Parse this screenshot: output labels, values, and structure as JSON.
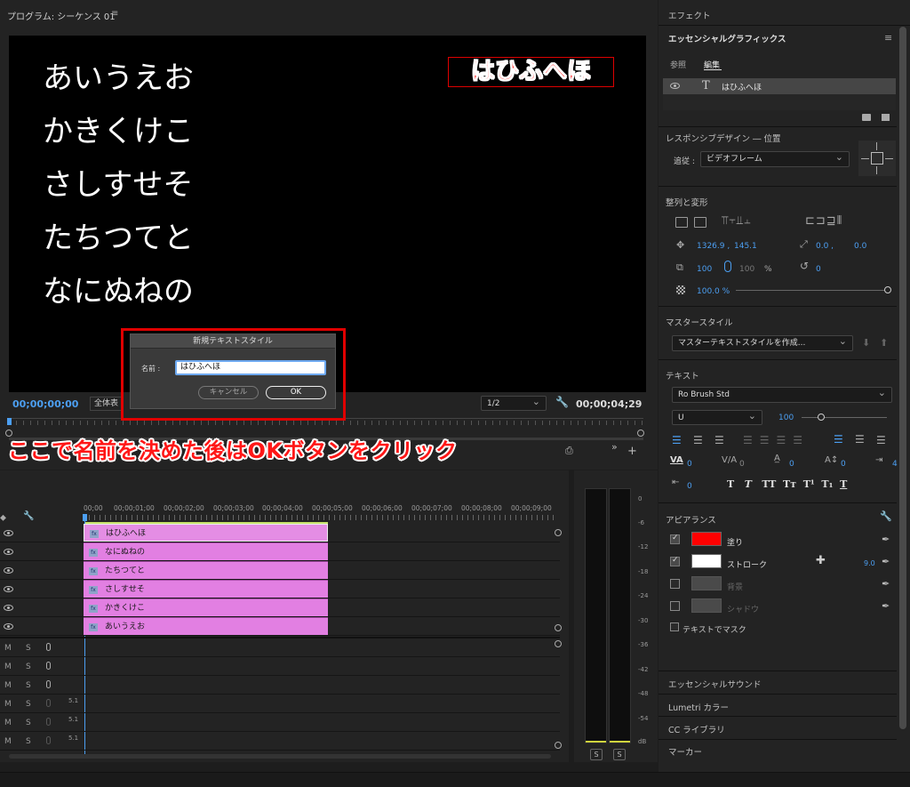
{
  "program": {
    "title": "プログラム: シーケンス 01",
    "menu_icon": "hamburger-icon",
    "canvas_lines": [
      "あいうえお",
      "かきくけこ",
      "さしすせそ",
      "たちつてと",
      "なにぬねの"
    ],
    "canvas_highlight": "はひふへほ",
    "timecode_left": "00;00;00;00",
    "fit_select": "全体表",
    "quality_select": "1/2",
    "timecode_right": "00;00;04;29"
  },
  "dialog": {
    "title": "新規テキストスタイル",
    "name_label": "名前 :",
    "name_value": "はひふへほ",
    "cancel_label": "キャンセル",
    "ok_label": "OK"
  },
  "annotation": "ここで名前を決めた後はOKボタンをクリック",
  "timeline": {
    "ruler": [
      "00;00",
      "00;00;01;00",
      "00;00;02;00",
      "00;00;03;00",
      "00;00;04;00",
      "00;00;05;00",
      "00;00;06;00",
      "00;00;07;00",
      "00;00;08;00",
      "00;00;09;00"
    ],
    "clips": [
      "はひふへほ",
      "なにぬねの",
      "たちつてと",
      "さしすせそ",
      "かきくけこ",
      "あいうえお"
    ],
    "fx_label": "fx",
    "audio_tracks": [
      {
        "m": "M",
        "s": "S",
        "ch": ""
      },
      {
        "m": "M",
        "s": "S",
        "ch": ""
      },
      {
        "m": "M",
        "s": "S",
        "ch": ""
      },
      {
        "m": "M",
        "s": "S",
        "ch": "5.1"
      },
      {
        "m": "M",
        "s": "S",
        "ch": "5.1"
      },
      {
        "m": "M",
        "s": "S",
        "ch": "5.1"
      }
    ]
  },
  "meter": {
    "labels": [
      "0",
      "-6",
      "-12",
      "-18",
      "-24",
      "-30",
      "-36",
      "-42",
      "-48",
      "-54",
      "dB"
    ],
    "solo_left": "S",
    "solo_right": "S"
  },
  "panel": {
    "effects_tab": "エフェクト",
    "title": "エッセンシャルグラフィックス",
    "tab_browse": "参照",
    "tab_edit": "編集",
    "layer_name": "はひふへほ",
    "responsive_title": "レスポンシブデザイン ― 位置",
    "follow_label": "追従 :",
    "follow_value": "ビデオフレーム",
    "align_title": "整列と変形",
    "pos_x": "1326.9 ,",
    "pos_y": "145.1",
    "anchor_x": "0.0 ,",
    "anchor_y": "0.0",
    "scale": "100",
    "scale_linked": "100",
    "scale_unit": "%",
    "rotation": "0",
    "opacity": "100.0 %",
    "master_title": "マスタースタイル",
    "master_value": "マスターテキストスタイルを作成...",
    "text_title": "テキスト",
    "font": "Ro Brush Std",
    "font_style": "U",
    "font_size": "100",
    "kerning": "0",
    "tracking": "0",
    "leading": "0",
    "baseline": "0",
    "tsume": "4",
    "tab_width": "0",
    "type_buttons": [
      "T",
      "T",
      "TT",
      "Tт",
      "T¹",
      "T₁",
      "T"
    ],
    "appearance_title": "アピアランス",
    "fill_label": "塗り",
    "stroke_label": "ストローク",
    "stroke_width": "9.0",
    "bg_label": "背景",
    "shadow_label": "シャドウ",
    "mask_label": "テキストでマスク",
    "fill_color": "#ff0000",
    "stroke_color": "#ffffff",
    "bottom_items": [
      "エッセンシャルサウンド",
      "Lumetri カラー",
      "CC ライブラリ",
      "マーカー"
    ]
  }
}
